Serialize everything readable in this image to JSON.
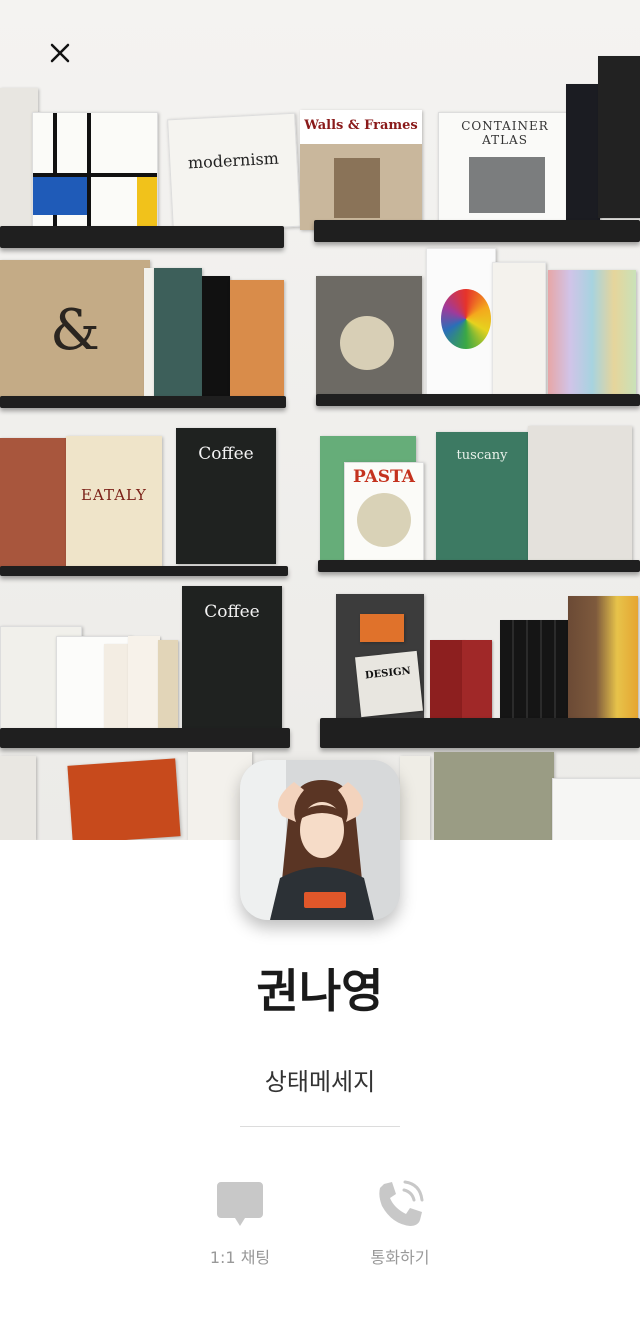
{
  "cover": {
    "icon": "close-icon"
  },
  "profile": {
    "name": "권나영",
    "status_message": "상태메세지"
  },
  "actions": [
    {
      "label": "1:1 채팅",
      "icon": "chat-bubble-icon"
    },
    {
      "label": "통화하기",
      "icon": "phone-icon"
    }
  ],
  "colors": {
    "icon_gray": "#c8c8c8",
    "label_gray": "#999999"
  }
}
